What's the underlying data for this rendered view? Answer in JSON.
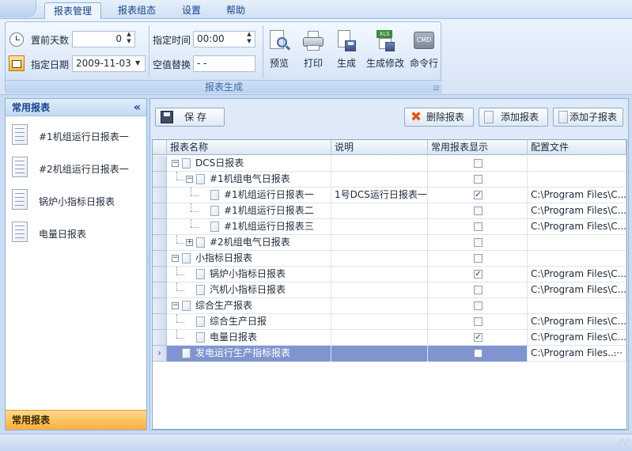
{
  "tabs": [
    {
      "label": "报表管理",
      "active": true
    },
    {
      "label": "报表组态"
    },
    {
      "label": "设置"
    },
    {
      "label": "帮助"
    }
  ],
  "ribbon": {
    "days_label": "置前天数",
    "days_value": "0",
    "date_label": "指定日期",
    "date_value": "2009-11-03",
    "time_label": "指定时间",
    "time_value": "00:00",
    "null_label": "空值替换",
    "null_value": "- -",
    "buttons": {
      "preview": "预览",
      "print": "打印",
      "generate": "生成",
      "generate_edit": "生成修改",
      "command": "命令行"
    },
    "cmd_icon_text": "CMD",
    "xls_icon_text": "XLS",
    "group_caption": "报表生成"
  },
  "left_panel": {
    "title": "常用报表",
    "collapse_glyph": "«",
    "items": [
      "#1机组运行日报表一",
      "#2机组运行日报表一",
      "锅炉小指标日报表",
      "电量日报表"
    ],
    "footer": "常用报表"
  },
  "toolbar": {
    "save": "保  存",
    "delete": "删除报表",
    "add": "添加报表",
    "add_child": "添加子报表"
  },
  "grid": {
    "columns": [
      "报表名称",
      "说明",
      "常用报表显示",
      "配置文件"
    ],
    "rows": [
      {
        "name": "DCS日报表",
        "desc": "",
        "checked": false,
        "file": ""
      },
      {
        "name": "#1机组电气日报表",
        "desc": "",
        "checked": false,
        "file": ""
      },
      {
        "name": "#1机组运行日报表一",
        "desc": "1号DCS运行日报表一",
        "checked": true,
        "file": "C:\\Program Files\\C..."
      },
      {
        "name": "#1机组运行日报表二",
        "desc": "",
        "checked": false,
        "file": "C:\\Program Files\\C..."
      },
      {
        "name": "#1机组运行日报表三",
        "desc": "",
        "checked": false,
        "file": "C:\\Program Files\\C..."
      },
      {
        "name": "#2机组电气日报表",
        "desc": "",
        "checked": false,
        "file": ""
      },
      {
        "name": "小指标日报表",
        "desc": "",
        "checked": false,
        "file": ""
      },
      {
        "name": "锅炉小指标日报表",
        "desc": "",
        "checked": true,
        "file": "C:\\Program Files\\C..."
      },
      {
        "name": "汽机小指标日报表",
        "desc": "",
        "checked": false,
        "file": "C:\\Program Files\\C..."
      },
      {
        "name": "综合生产报表",
        "desc": "",
        "checked": false,
        "file": ""
      },
      {
        "name": "综合生产日报",
        "desc": "",
        "checked": false,
        "file": "C:\\Program Files\\C..."
      },
      {
        "name": "电量日报表",
        "desc": "",
        "checked": true,
        "file": "C:\\Program Files\\C..."
      },
      {
        "name": "发电运行生产指标报表",
        "desc": "",
        "checked": false,
        "file": "C:\\Program Files..."
      }
    ],
    "current_row_marker": "›",
    "ellipsis_button": "···",
    "checkmark": "✓",
    "expand_minus": "−",
    "expand_plus": "+"
  },
  "colors": {
    "selected_row": "#8094cf",
    "footer_accent": "#fbb03b",
    "delete_icon": "#e25a1c"
  }
}
